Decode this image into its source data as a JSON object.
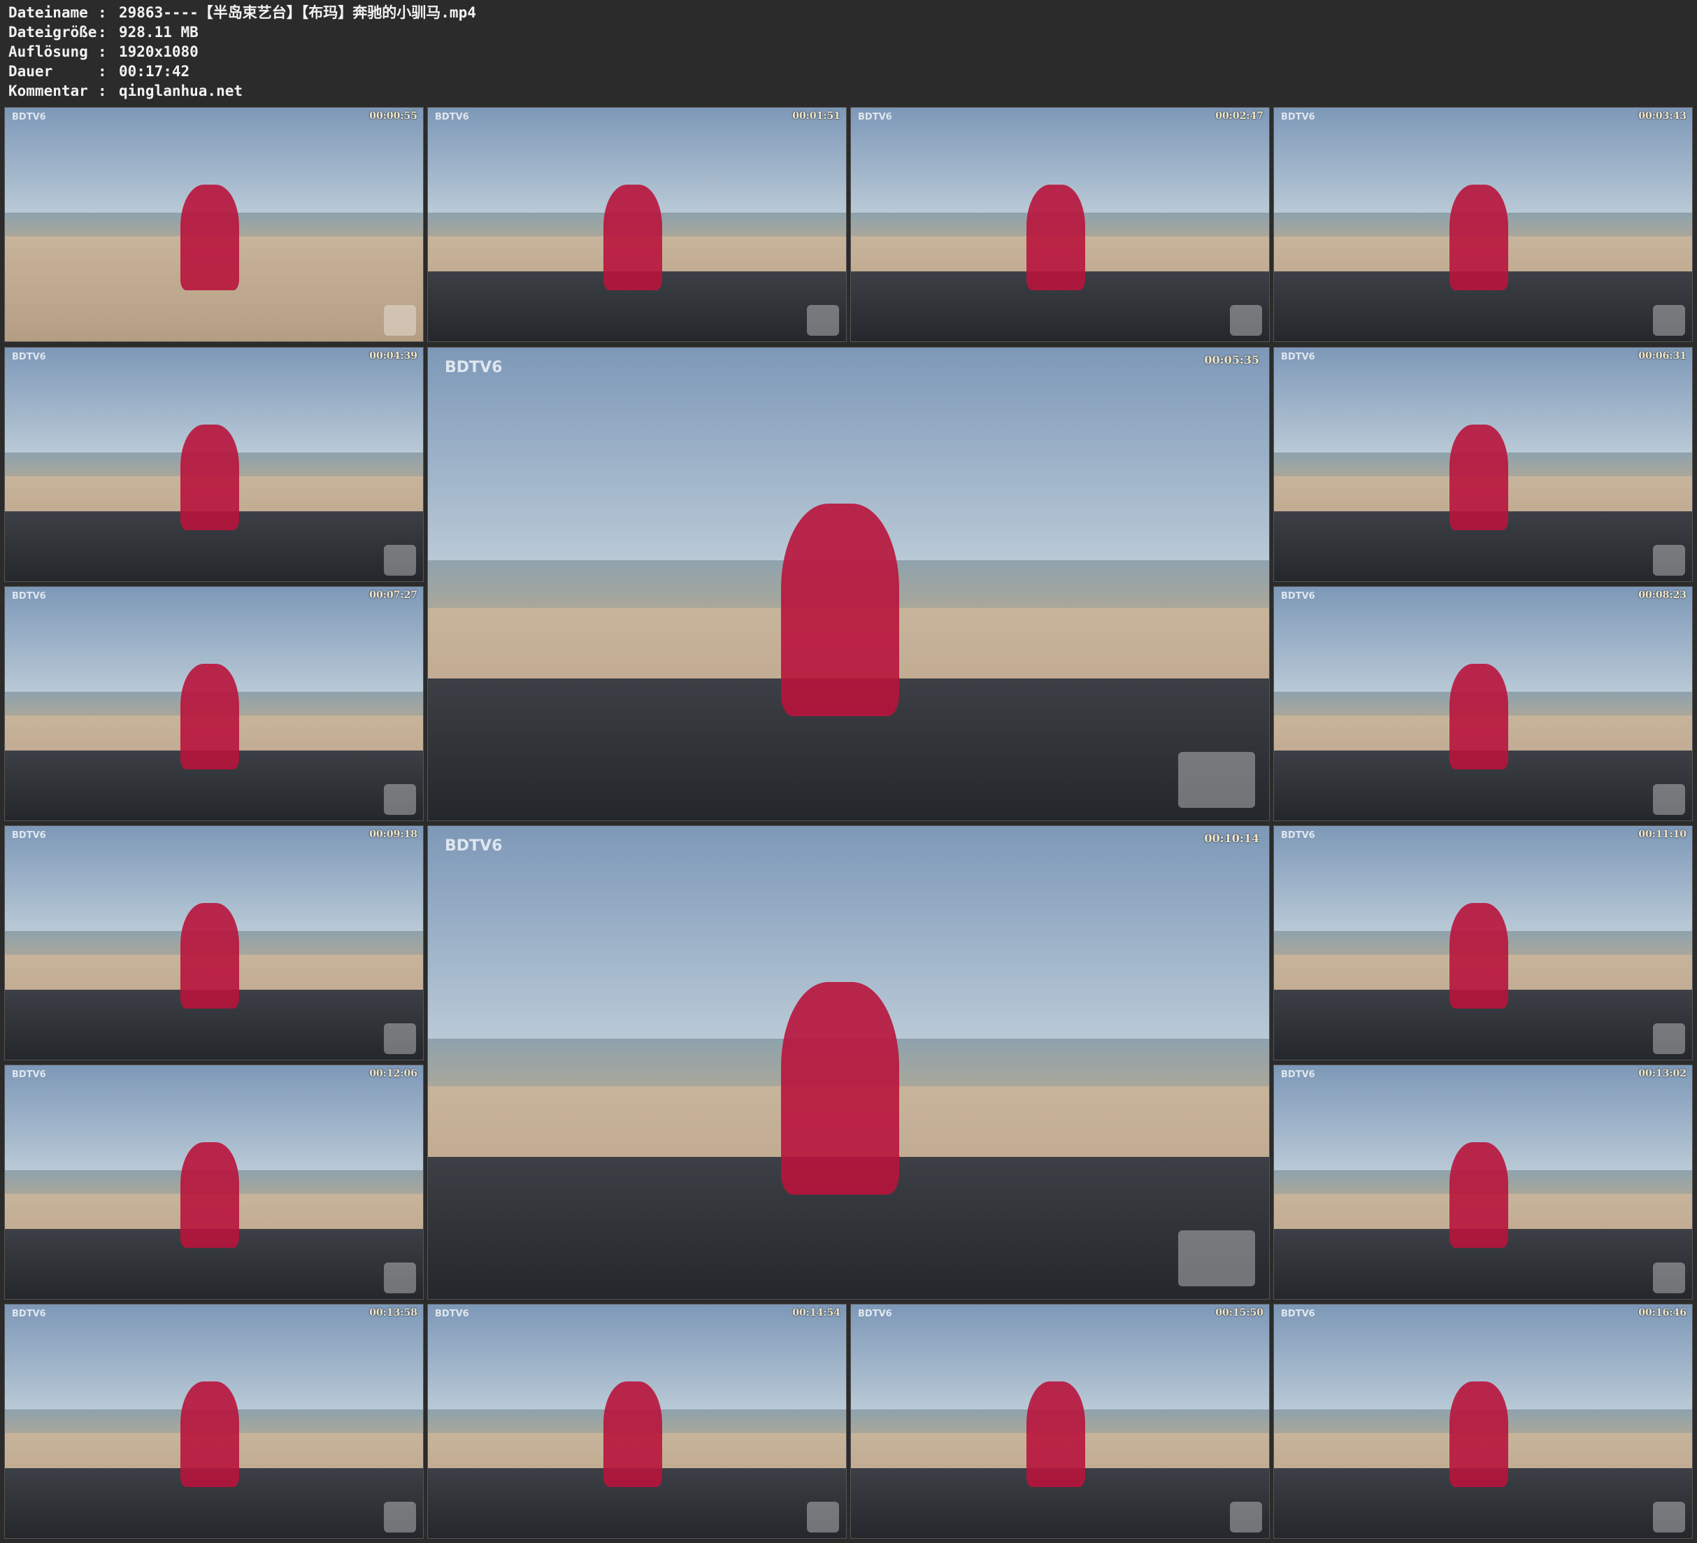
{
  "meta": {
    "rows": [
      {
        "key": "Dateiname",
        "value": "29863----【半岛束艺台】【布玛】奔驰的小驯马.mp4"
      },
      {
        "key": "Dateigröße",
        "value": "928.11 MB"
      },
      {
        "key": "Auflösung",
        "value": "1920x1080"
      },
      {
        "key": "Dauer",
        "value": "00:17:42"
      },
      {
        "key": "Kommentar",
        "value": "qinglanhua.net"
      }
    ],
    "separator": ":"
  },
  "logo_text": "BDTV6",
  "thumbnails": [
    {
      "time": "00:00:55",
      "size": "small",
      "scene": "beach-standing"
    },
    {
      "time": "00:01:51",
      "size": "small",
      "scene": "car-standing"
    },
    {
      "time": "00:02:47",
      "size": "small",
      "scene": "car-roof"
    },
    {
      "time": "00:03:43",
      "size": "small",
      "scene": "car-roof"
    },
    {
      "time": "00:04:39",
      "size": "small",
      "scene": "car-roof"
    },
    {
      "time": "00:05:35",
      "size": "large",
      "scene": "car-window"
    },
    {
      "time": "00:06:31",
      "size": "small",
      "scene": "car-roof"
    },
    {
      "time": "00:07:27",
      "size": "small",
      "scene": "car-roof"
    },
    {
      "time": "00:08:23",
      "size": "small",
      "scene": "car-roof"
    },
    {
      "time": "00:09:18",
      "size": "small",
      "scene": "car-roof"
    },
    {
      "time": "00:10:14",
      "size": "large",
      "scene": "car-roof"
    },
    {
      "time": "00:11:10",
      "size": "small",
      "scene": "car-roof"
    },
    {
      "time": "00:12:06",
      "size": "small",
      "scene": "car-roof"
    },
    {
      "time": "00:13:02",
      "size": "small",
      "scene": "car-roof"
    },
    {
      "time": "00:13:58",
      "size": "small",
      "scene": "car-roof"
    },
    {
      "time": "00:14:54",
      "size": "small",
      "scene": "car-roof"
    },
    {
      "time": "00:15:50",
      "size": "small",
      "scene": "car-roof"
    },
    {
      "time": "00:16:46",
      "size": "small",
      "scene": "car-roof"
    }
  ]
}
